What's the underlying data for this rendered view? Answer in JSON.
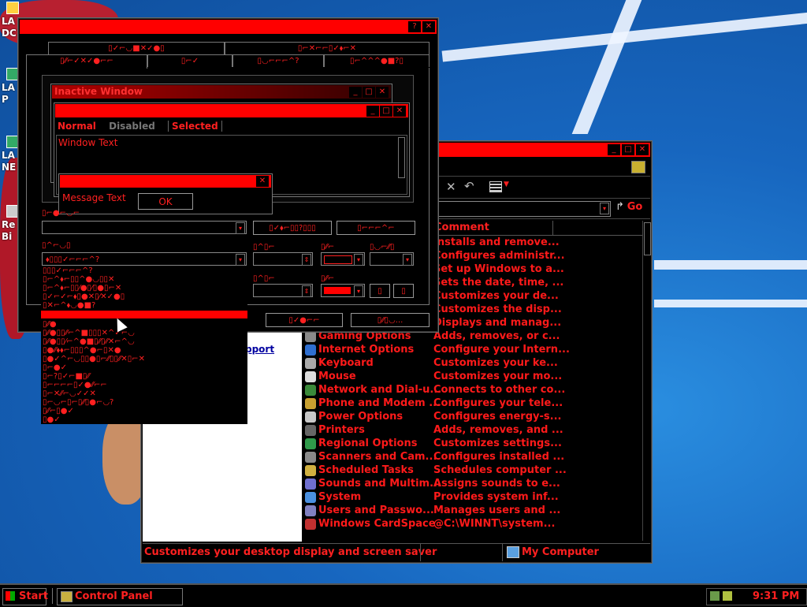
{
  "desktop": {
    "icons": [
      {
        "label": "LA\nDC"
      },
      {
        "label": "LA\nP"
      },
      {
        "label": "LA\nNE"
      },
      {
        "label": "Re\nBi"
      }
    ]
  },
  "props_window": {
    "tabs_row1": [
      "▯✓⌐◡■✕✓●▯",
      "▯⌐✕⌐⌐▯✓⬧⌐✕"
    ],
    "tabs_row2": [
      "▯⁄⁄⌐✓✕✓●⌐⌐",
      "▯⌐✓",
      "▯◡⌐⌐⌐^?",
      "▯⌐^^^●■?▯"
    ],
    "preview": {
      "inactive_title": "Inactive Window",
      "menu_normal": "Normal",
      "menu_disabled": "Disabled",
      "menu_selected": "Selected",
      "window_text": "Window Text",
      "message_text": "Message Text",
      "ok": "OK"
    },
    "scheme_label": "▯⌐●⌐◡⌐",
    "save_btn": "▯✓⬧⌐▯▯?▯▯▯",
    "delete_btn": "▯⌐⌐⌐^⌐",
    "item_label": "▯^⌐◡▯",
    "item_value": "⬧▯▯▯✓⌐⌐⌐^?",
    "size_label": "▯^▯⌐",
    "color_label": "▯⁄⁄⌐",
    "color2_label": "▯◡⌐⁄⁄▯",
    "font_label": "▯^▯⌐",
    "font_color_label": "▯⁄⁄⌐",
    "bold_btn": "▯",
    "italic_btn": "▯",
    "ok_btn": "▯✓●⌐⌐",
    "cancel_btn": "▯⁄⁄▯◡..."
  },
  "dropdown": {
    "items": [
      "▯▯▯✓⌐⌐⌐^?",
      "▯⌐^⬧⌐▯▯^●◡▯▯✕",
      "▯⌐^⬧⌐▯▯⁄●▯⁄▯●▯⌐✕",
      "▯✓⌐✓⌐⬧▯●✕▯⁄✕✓●▯",
      "▯✕⌐^⬧◡●■?"
    ],
    "list_items": [
      "▯⁄⁄●",
      "▯⁄⁄●▯▯⁄⁄⌐^■▯▯▯✕^✓⌐◡",
      "▯⁄⁄●▯▯⁄⌐^●■▯⁄⁄▯⁄⁄✕⌐^◡",
      "▯●⁄⁄⬧⬧⌐▯▯▯^●⌐▯✕●",
      "▯●✓^⌐◡▯▯●▯⌐⁄⁄▯▯⁄⁄✕▯⌐✕",
      "▯⌐●✓",
      "▯⌐?▯✓⌐■▯⁄⁄",
      "▯⌐⌐⌐⌐▯✓●⁄⁄⌐⌐",
      "▯⌐✕⁄⁄⌐◡✓✓✕",
      "▯⌐◡⌐▯⌐▯⁄⁄▯●⌐◡?",
      "▯⁄⁄⌐▯●✓",
      "▯●✓"
    ]
  },
  "control_panel": {
    "address_go": "Go",
    "comment_header": "Comment",
    "left_link": "pport",
    "rows": [
      {
        "name": "",
        "comment": "Installs and remove..."
      },
      {
        "name": "",
        "comment": "Configures administr..."
      },
      {
        "name": "",
        "comment": "Set up Windows to a..."
      },
      {
        "name": "",
        "comment": "Sets the date, time, ..."
      },
      {
        "name": "",
        "comment": "Customizes your de..."
      },
      {
        "name": "",
        "comment": "Customizes the disp..."
      },
      {
        "name": "",
        "comment": "Displays and manag..."
      },
      {
        "name": "Gaming Options",
        "comment": "Adds, removes, or c..."
      },
      {
        "name": "Internet Options",
        "comment": "Configure your Intern..."
      },
      {
        "name": "Keyboard",
        "comment": "Customizes your ke..."
      },
      {
        "name": "Mouse",
        "comment": "Customizes your mo..."
      },
      {
        "name": "Network and Dial-u...",
        "comment": "Connects to other co..."
      },
      {
        "name": "Phone and Modem ...",
        "comment": "Configures your tele..."
      },
      {
        "name": "Power Options",
        "comment": "Configures energy-s..."
      },
      {
        "name": "Printers",
        "comment": "Adds, removes, and ..."
      },
      {
        "name": "Regional Options",
        "comment": "Customizes settings..."
      },
      {
        "name": "Scanners and Cam...",
        "comment": "Configures installed ..."
      },
      {
        "name": "Scheduled Tasks",
        "comment": "Schedules computer ..."
      },
      {
        "name": "Sounds and Multim...",
        "comment": "Assigns sounds to e..."
      },
      {
        "name": "System",
        "comment": "Provides system inf..."
      },
      {
        "name": "Users and Passwo...",
        "comment": "Manages users and ..."
      },
      {
        "name": "Windows CardSpace",
        "comment": "@C:\\WINNT\\system..."
      }
    ],
    "icon_colors": [
      "#8a8a8a",
      "#2f6fd0",
      "#aaaaaa",
      "#dddddd",
      "#3a8a3a",
      "#c8a030",
      "#c8c8c8",
      "#666666",
      "#2f9a4a",
      "#8a8a8a",
      "#d0b040",
      "#7070d0",
      "#4a90e0",
      "#8080c0",
      "#c03030"
    ],
    "status_text": "Customizes your desktop display and screen saver",
    "status_location": "My Computer"
  },
  "taskbar": {
    "start": "Start",
    "task": "Control Panel",
    "clock": "9:31 PM"
  },
  "colors": {
    "accent": "#ff0000",
    "text": "#ff2020",
    "background": "#000000"
  }
}
